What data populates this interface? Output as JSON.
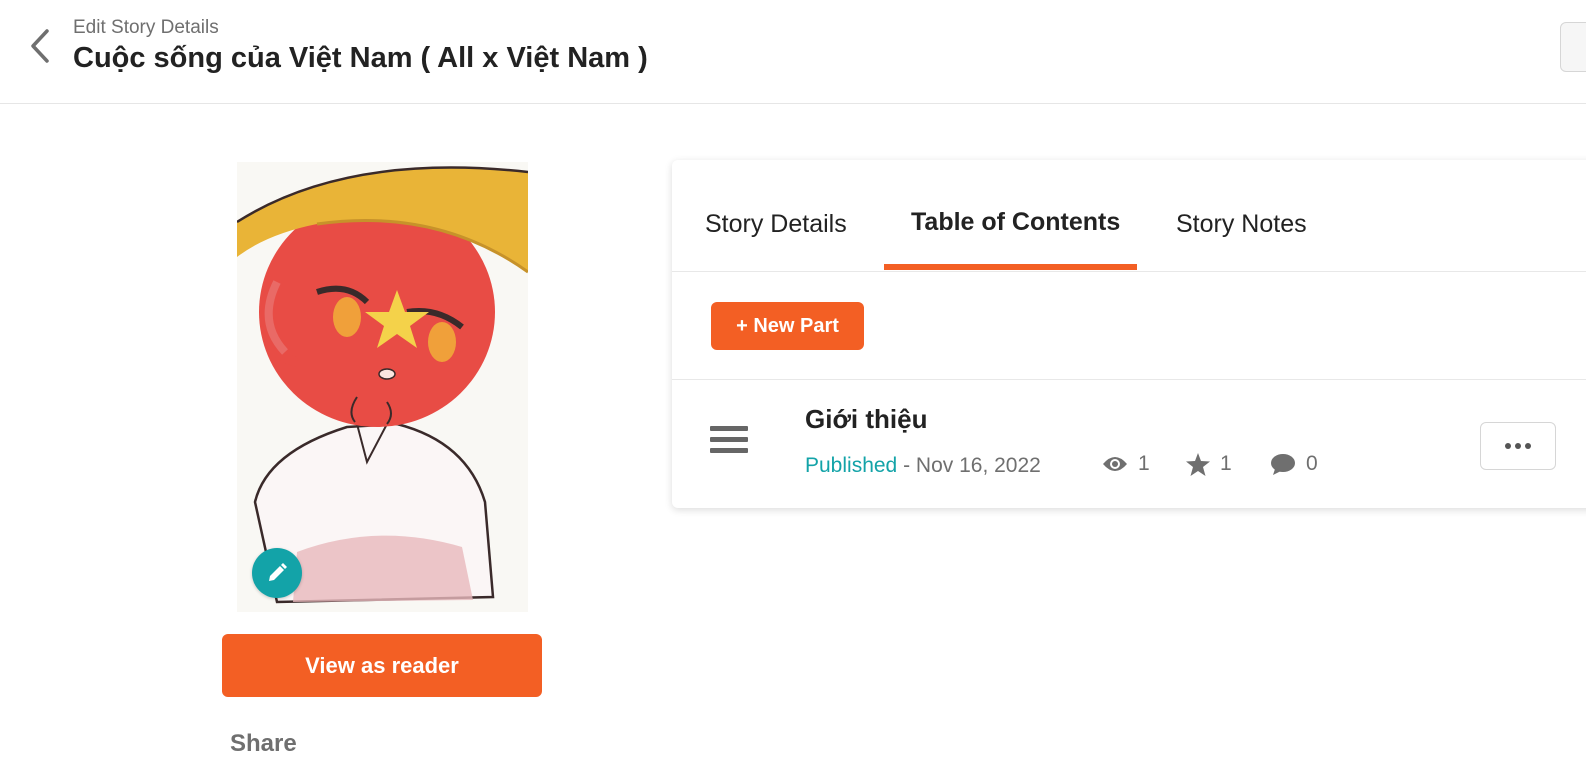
{
  "header": {
    "subtitle": "Edit Story Details",
    "title": "Cuộc sống của Việt Nam ( All x Việt Nam )"
  },
  "sidebar": {
    "view_as_reader_label": "View as reader",
    "share_label": "Share"
  },
  "tabs": [
    {
      "label": "Story Details",
      "active": false
    },
    {
      "label": "Table of Contents",
      "active": true
    },
    {
      "label": "Story Notes",
      "active": false
    }
  ],
  "toc": {
    "new_part_label": "+ New Part",
    "parts": [
      {
        "title": "Giới thiệu",
        "status": "Published",
        "separator": " - ",
        "date": "Nov 16, 2022",
        "views": "1",
        "votes": "1",
        "comments": "0"
      }
    ]
  },
  "colors": {
    "accent": "#f35f24",
    "teal": "#13a3a8",
    "text": "#222222",
    "muted": "#6f6f6f"
  },
  "icons": [
    "back-arrow-icon",
    "pencil-icon",
    "hamburger-drag-icon",
    "eye-icon",
    "star-icon",
    "comment-icon",
    "ellipsis-icon"
  ]
}
